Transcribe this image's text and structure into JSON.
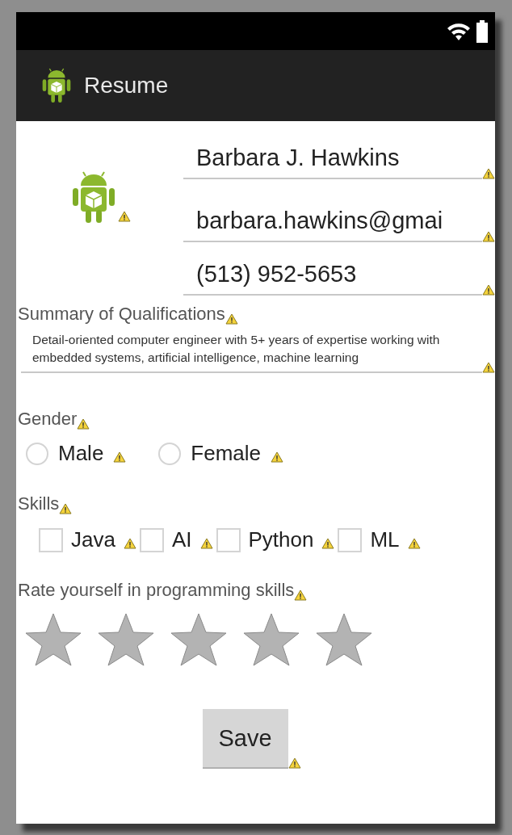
{
  "app_bar": {
    "title": "Resume"
  },
  "fields": [
    {
      "value": "Barbara J. Hawkins"
    },
    {
      "value": "barbara.hawkins@gmai"
    },
    {
      "value": "(513) 952-5653"
    }
  ],
  "summary": {
    "label": "Summary of Qualifications",
    "value": "Detail-oriented computer engineer with 5+ years of expertise working with embedded systems, artificial intelligence, machine learning"
  },
  "gender": {
    "label": "Gender",
    "options": [
      {
        "label": "Male",
        "selected": false
      },
      {
        "label": "Female",
        "selected": false
      }
    ]
  },
  "skills": {
    "label": "Skills",
    "options": [
      {
        "label": "Java",
        "checked": false
      },
      {
        "label": "AI",
        "checked": false
      },
      {
        "label": "Python",
        "checked": false
      },
      {
        "label": "ML",
        "checked": false
      }
    ]
  },
  "rating": {
    "label": "Rate yourself in programming skills",
    "stars": 0
  },
  "save_button": {
    "label": "Save"
  }
}
